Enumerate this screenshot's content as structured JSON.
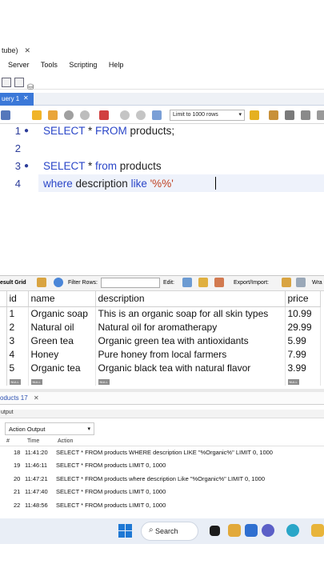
{
  "window": {
    "tab_title": "tube)"
  },
  "menu": [
    "Server",
    "Tools",
    "Scripting",
    "Help"
  ],
  "query_tab": {
    "label": "uery 1"
  },
  "sql_toolbar": {
    "limit_label": "Limit to 1000 rows"
  },
  "editor": {
    "lines": [
      {
        "num": "1",
        "text_kw1": "SELECT",
        "text_rest1": " * ",
        "text_kw2": "FROM",
        "text_rest2": " products;"
      },
      {
        "num": "2"
      },
      {
        "num": "3",
        "text_kw1": "SELECT",
        "text_rest1": " * ",
        "text_kw2": "from",
        "text_rest2": " products"
      },
      {
        "num": "4",
        "text_kw1": "where",
        "text_rest1": " description ",
        "text_kw2": "like",
        "text_str": "'%%'"
      }
    ]
  },
  "result_grid": {
    "label": "esult Grid",
    "filter_label": "Filter Rows:",
    "edit_label": "Edit:",
    "export_label": "Export/Import:",
    "wrap_label": "Wra",
    "columns": [
      "id",
      "name",
      "description",
      "price"
    ],
    "rows": [
      [
        "1",
        "Organic soap",
        "This is an organic soap for all skin types",
        "10.99"
      ],
      [
        "2",
        "Natural oil",
        "Natural oil for aromatherapy",
        "29.99"
      ],
      [
        "3",
        "Green tea",
        "Organic green tea with antioxidants",
        "5.99"
      ],
      [
        "4",
        "Honey",
        "Pure honey from local farmers",
        "7.99"
      ],
      [
        "5",
        "Organic tea",
        "Organic black tea with natural flavor",
        "3.99"
      ]
    ],
    "null_label": "NULL"
  },
  "result_tab": {
    "label": "oducts 17"
  },
  "output": {
    "header": "utput",
    "selector": "Action Output",
    "col_hash": "#",
    "col_time": "Time",
    "col_action": "Action",
    "rows": [
      {
        "n": "18",
        "time": "11:41:20",
        "action": "SELECT * FROM products WHERE description LIKE \"%Organic%\" LIMIT 0, 1000"
      },
      {
        "n": "19",
        "time": "11:46:11",
        "action": "SELECT * FROM products LIMIT 0, 1000"
      },
      {
        "n": "20",
        "time": "11:47:21",
        "action": "SELECT * FROM products where description Like \"%Organic%\" LIMIT 0, 1000"
      },
      {
        "n": "21",
        "time": "11:47:40",
        "action": "SELECT * FROM products LIMIT 0, 1000"
      },
      {
        "n": "22",
        "time": "11:48:56",
        "action": "SELECT * FROM products LIMIT 0, 1000"
      }
    ]
  },
  "taskbar": {
    "search_label": "Search"
  },
  "colors": {
    "accent": "#3b78d8",
    "keyword": "#2a46c8",
    "string": "#c04020"
  }
}
